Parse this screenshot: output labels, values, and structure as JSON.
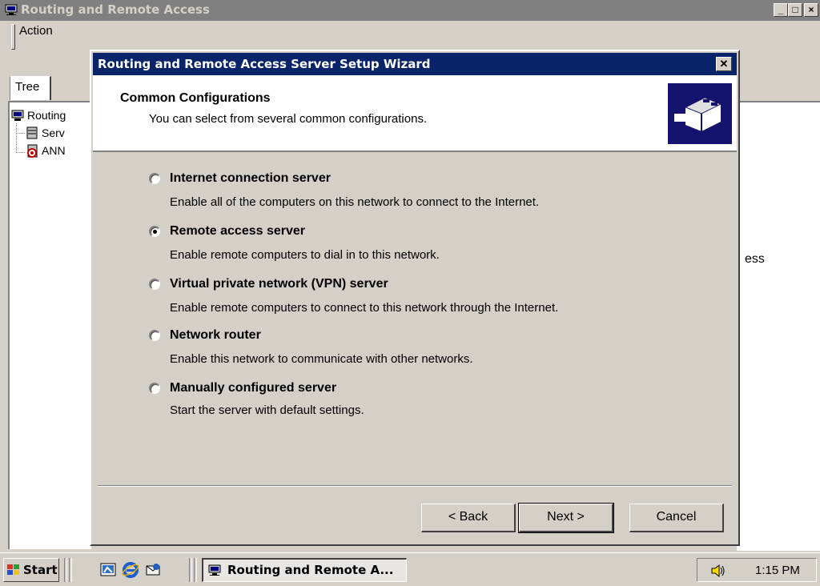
{
  "main_window": {
    "title": "Routing and Remote Access",
    "menu_action": "Action",
    "tab_tree": "Tree",
    "tree_items": [
      "Routing",
      "Serv",
      "ANN"
    ],
    "right_pane_text": "ess"
  },
  "wizard": {
    "title": "Routing and Remote Access Server Setup Wizard",
    "header_title": "Common Configurations",
    "header_subtitle": "You can select from several common configurations.",
    "options": [
      {
        "label": "Internet connection server",
        "description": "Enable all of the computers on this network to connect to the Internet.",
        "checked": false
      },
      {
        "label": "Remote access server",
        "description": "Enable remote computers to dial in to this network.",
        "checked": true
      },
      {
        "label": "Virtual private network (VPN) server",
        "description": "Enable remote computers to connect to this network through the Internet.",
        "checked": false
      },
      {
        "label": "Network router",
        "description": "Enable this network to communicate with other networks.",
        "checked": false
      },
      {
        "label": "Manually configured server",
        "description": "Start the server with default settings.",
        "checked": false
      }
    ],
    "buttons": {
      "back": "< Back",
      "next": "Next >",
      "cancel": "Cancel"
    }
  },
  "taskbar": {
    "start_label": "Start",
    "task_label": "Routing and Remote A...",
    "clock": "1:15 PM"
  },
  "colors": {
    "titlebar_active": "#0a246a",
    "titlebar_inactive": "#808080",
    "face": "#d4d0c8"
  }
}
